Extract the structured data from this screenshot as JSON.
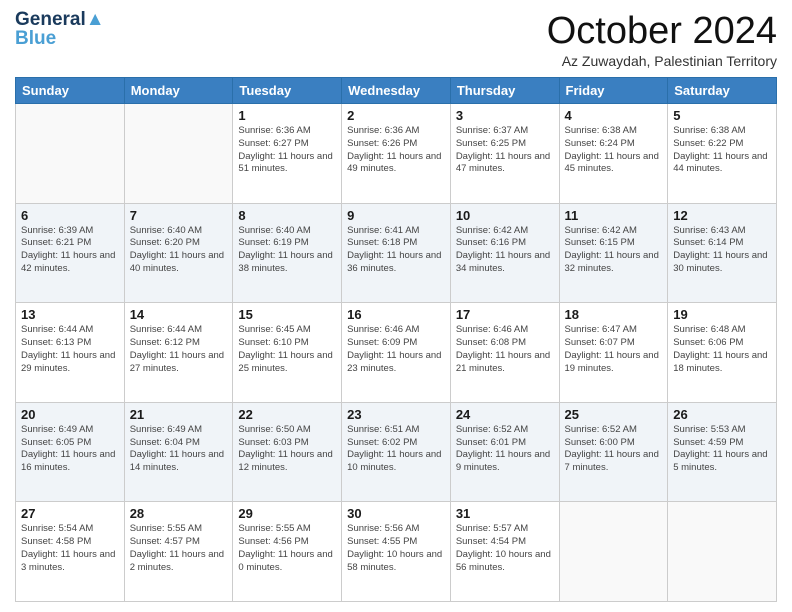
{
  "header": {
    "logo_line1": "General",
    "logo_line2": "Blue",
    "month": "October 2024",
    "location": "Az Zuwaydah, Palestinian Territory"
  },
  "weekdays": [
    "Sunday",
    "Monday",
    "Tuesday",
    "Wednesday",
    "Thursday",
    "Friday",
    "Saturday"
  ],
  "weeks": [
    [
      {
        "day": "",
        "info": ""
      },
      {
        "day": "",
        "info": ""
      },
      {
        "day": "1",
        "info": "Sunrise: 6:36 AM\nSunset: 6:27 PM\nDaylight: 11 hours and 51 minutes."
      },
      {
        "day": "2",
        "info": "Sunrise: 6:36 AM\nSunset: 6:26 PM\nDaylight: 11 hours and 49 minutes."
      },
      {
        "day": "3",
        "info": "Sunrise: 6:37 AM\nSunset: 6:25 PM\nDaylight: 11 hours and 47 minutes."
      },
      {
        "day": "4",
        "info": "Sunrise: 6:38 AM\nSunset: 6:24 PM\nDaylight: 11 hours and 45 minutes."
      },
      {
        "day": "5",
        "info": "Sunrise: 6:38 AM\nSunset: 6:22 PM\nDaylight: 11 hours and 44 minutes."
      }
    ],
    [
      {
        "day": "6",
        "info": "Sunrise: 6:39 AM\nSunset: 6:21 PM\nDaylight: 11 hours and 42 minutes."
      },
      {
        "day": "7",
        "info": "Sunrise: 6:40 AM\nSunset: 6:20 PM\nDaylight: 11 hours and 40 minutes."
      },
      {
        "day": "8",
        "info": "Sunrise: 6:40 AM\nSunset: 6:19 PM\nDaylight: 11 hours and 38 minutes."
      },
      {
        "day": "9",
        "info": "Sunrise: 6:41 AM\nSunset: 6:18 PM\nDaylight: 11 hours and 36 minutes."
      },
      {
        "day": "10",
        "info": "Sunrise: 6:42 AM\nSunset: 6:16 PM\nDaylight: 11 hours and 34 minutes."
      },
      {
        "day": "11",
        "info": "Sunrise: 6:42 AM\nSunset: 6:15 PM\nDaylight: 11 hours and 32 minutes."
      },
      {
        "day": "12",
        "info": "Sunrise: 6:43 AM\nSunset: 6:14 PM\nDaylight: 11 hours and 30 minutes."
      }
    ],
    [
      {
        "day": "13",
        "info": "Sunrise: 6:44 AM\nSunset: 6:13 PM\nDaylight: 11 hours and 29 minutes."
      },
      {
        "day": "14",
        "info": "Sunrise: 6:44 AM\nSunset: 6:12 PM\nDaylight: 11 hours and 27 minutes."
      },
      {
        "day": "15",
        "info": "Sunrise: 6:45 AM\nSunset: 6:10 PM\nDaylight: 11 hours and 25 minutes."
      },
      {
        "day": "16",
        "info": "Sunrise: 6:46 AM\nSunset: 6:09 PM\nDaylight: 11 hours and 23 minutes."
      },
      {
        "day": "17",
        "info": "Sunrise: 6:46 AM\nSunset: 6:08 PM\nDaylight: 11 hours and 21 minutes."
      },
      {
        "day": "18",
        "info": "Sunrise: 6:47 AM\nSunset: 6:07 PM\nDaylight: 11 hours and 19 minutes."
      },
      {
        "day": "19",
        "info": "Sunrise: 6:48 AM\nSunset: 6:06 PM\nDaylight: 11 hours and 18 minutes."
      }
    ],
    [
      {
        "day": "20",
        "info": "Sunrise: 6:49 AM\nSunset: 6:05 PM\nDaylight: 11 hours and 16 minutes."
      },
      {
        "day": "21",
        "info": "Sunrise: 6:49 AM\nSunset: 6:04 PM\nDaylight: 11 hours and 14 minutes."
      },
      {
        "day": "22",
        "info": "Sunrise: 6:50 AM\nSunset: 6:03 PM\nDaylight: 11 hours and 12 minutes."
      },
      {
        "day": "23",
        "info": "Sunrise: 6:51 AM\nSunset: 6:02 PM\nDaylight: 11 hours and 10 minutes."
      },
      {
        "day": "24",
        "info": "Sunrise: 6:52 AM\nSunset: 6:01 PM\nDaylight: 11 hours and 9 minutes."
      },
      {
        "day": "25",
        "info": "Sunrise: 6:52 AM\nSunset: 6:00 PM\nDaylight: 11 hours and 7 minutes."
      },
      {
        "day": "26",
        "info": "Sunrise: 5:53 AM\nSunset: 4:59 PM\nDaylight: 11 hours and 5 minutes."
      }
    ],
    [
      {
        "day": "27",
        "info": "Sunrise: 5:54 AM\nSunset: 4:58 PM\nDaylight: 11 hours and 3 minutes."
      },
      {
        "day": "28",
        "info": "Sunrise: 5:55 AM\nSunset: 4:57 PM\nDaylight: 11 hours and 2 minutes."
      },
      {
        "day": "29",
        "info": "Sunrise: 5:55 AM\nSunset: 4:56 PM\nDaylight: 11 hours and 0 minutes."
      },
      {
        "day": "30",
        "info": "Sunrise: 5:56 AM\nSunset: 4:55 PM\nDaylight: 10 hours and 58 minutes."
      },
      {
        "day": "31",
        "info": "Sunrise: 5:57 AM\nSunset: 4:54 PM\nDaylight: 10 hours and 56 minutes."
      },
      {
        "day": "",
        "info": ""
      },
      {
        "day": "",
        "info": ""
      }
    ]
  ]
}
